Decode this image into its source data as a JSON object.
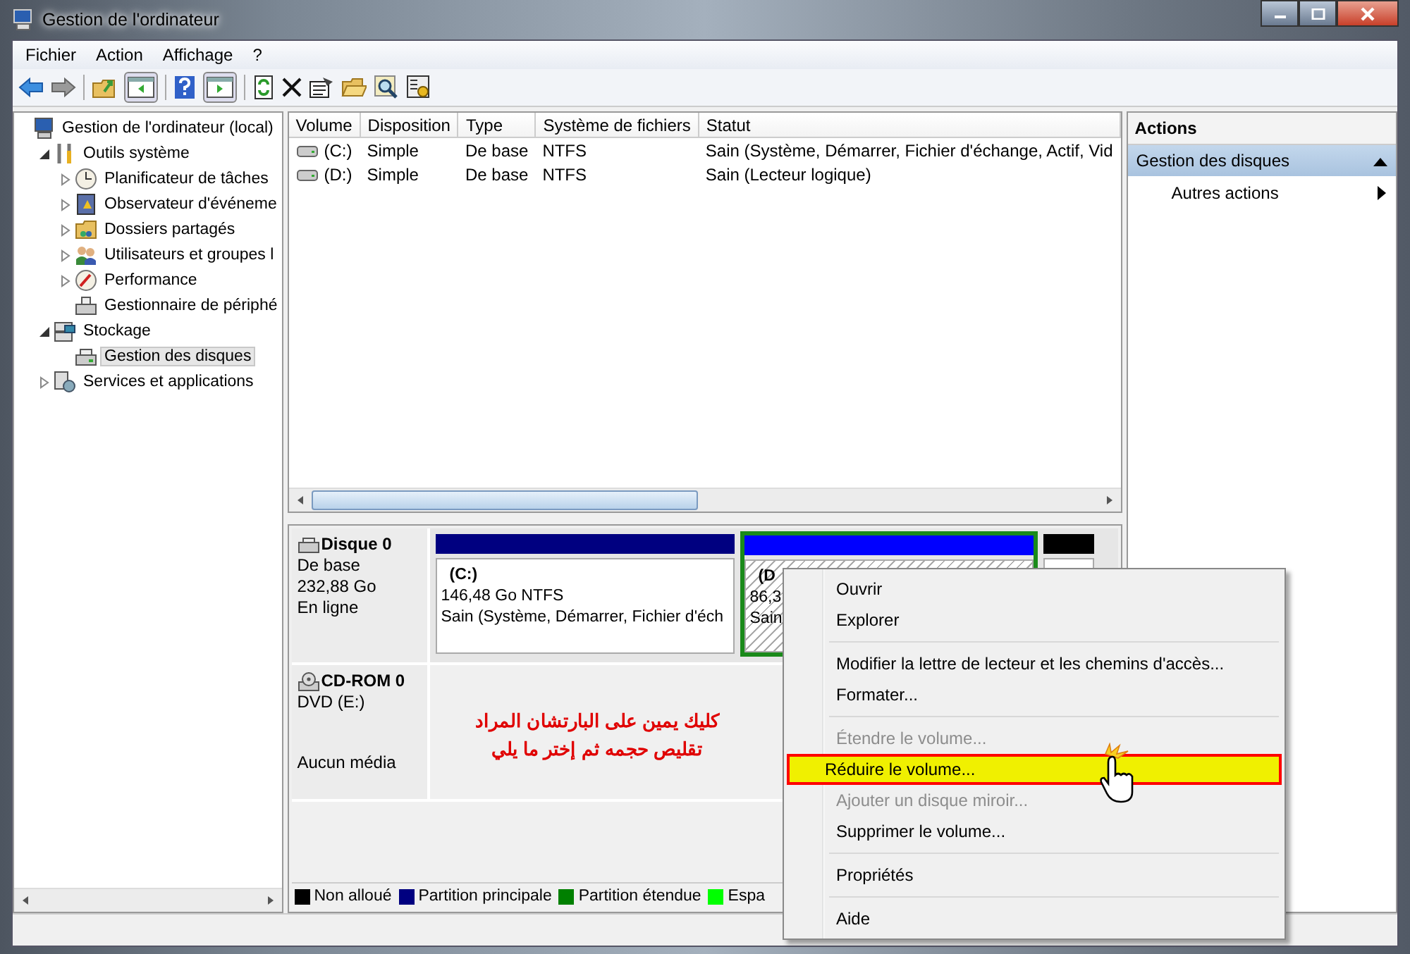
{
  "window": {
    "title": "Gestion de l'ordinateur"
  },
  "menu": [
    "Fichier",
    "Action",
    "Affichage",
    "?"
  ],
  "tree": [
    {
      "label": "Gestion de l'ordinateur (local)",
      "kind": "node",
      "selected": false,
      "children": [
        {
          "label": "Outils système",
          "kind": "branch",
          "expanded": true,
          "selected": false,
          "children": [
            {
              "label": "Planificateur de tâches",
              "kind": "branch",
              "expanded": false,
              "selected": false
            },
            {
              "label": "Observateur d'événeme",
              "kind": "branch",
              "expanded": false,
              "selected": false
            },
            {
              "label": "Dossiers partagés",
              "kind": "branch",
              "expanded": false,
              "selected": false
            },
            {
              "label": "Utilisateurs et groupes l",
              "kind": "branch",
              "expanded": false,
              "selected": false
            },
            {
              "label": "Performance",
              "kind": "branch",
              "expanded": false,
              "selected": false
            },
            {
              "label": "Gestionnaire de périphé",
              "kind": "node",
              "selected": false
            }
          ]
        },
        {
          "label": "Stockage",
          "kind": "branch",
          "expanded": true,
          "selected": false,
          "children": [
            {
              "label": "Gestion des disques",
              "kind": "node",
              "selected": true
            }
          ]
        },
        {
          "label": "Services et applications",
          "kind": "branch",
          "expanded": false,
          "selected": false
        }
      ]
    }
  ],
  "volumes": {
    "columns": [
      "Volume",
      "Disposition",
      "Type",
      "Système de fichiers",
      "Statut"
    ],
    "rows": [
      {
        "cells": [
          "(C:)",
          "Simple",
          "De base",
          "NTFS",
          "Sain (Système, Démarrer, Fichier d'échange, Actif, Vid"
        ]
      },
      {
        "cells": [
          "(D:)",
          "Simple",
          "De base",
          "NTFS",
          "Sain (Lecteur logique)"
        ]
      }
    ]
  },
  "disks": [
    {
      "kind": "disk",
      "name": "Disque 0",
      "lines": [
        "De base",
        "232,88 Go",
        "En ligne"
      ],
      "partitions": [
        {
          "kind": "primary",
          "selected": false,
          "lines": [
            "(C:)",
            "146,48 Go NTFS",
            "Sain (Système, Démarrer, Fichier d'éch"
          ]
        },
        {
          "kind": "logical",
          "selected": true,
          "lines": [
            "(D",
            "86,3",
            "Sain"
          ]
        },
        {
          "kind": "unallocated"
        }
      ]
    },
    {
      "kind": "cdrom",
      "name": "CD-ROM 0",
      "lines": [
        "DVD (E:)",
        "Aucun média"
      ],
      "annotation": [
        "كليك يمين على البارتشان المراد",
        "تقليص حجمه ثم إختر ما يلي"
      ]
    }
  ],
  "legend": [
    {
      "label": "Non alloué",
      "color": "#000000"
    },
    {
      "label": "Partition principale",
      "color": "#000080"
    },
    {
      "label": "Partition étendue",
      "color": "#008000"
    },
    {
      "label": "Espa",
      "color": "#00ff00"
    }
  ],
  "actions": {
    "header": "Actions",
    "sections": [
      {
        "title": "Gestion des disques",
        "expanded": true,
        "items": [
          "Autres actions"
        ]
      }
    ]
  },
  "context_menu": [
    {
      "kind": "item",
      "label": "Ouvrir",
      "disabled": false,
      "selected": false
    },
    {
      "kind": "item",
      "label": "Explorer",
      "disabled": false,
      "selected": false
    },
    {
      "kind": "separator"
    },
    {
      "kind": "item",
      "label": "Modifier la lettre de lecteur et les chemins d'accès...",
      "disabled": false,
      "selected": false
    },
    {
      "kind": "item",
      "label": "Formater...",
      "disabled": false,
      "selected": false
    },
    {
      "kind": "separator"
    },
    {
      "kind": "item",
      "label": "Étendre le volume...",
      "disabled": true,
      "selected": false
    },
    {
      "kind": "item",
      "label": "Réduire le volume...",
      "disabled": false,
      "selected": true
    },
    {
      "kind": "item",
      "label": "Ajouter un disque miroir...",
      "disabled": true,
      "selected": false
    },
    {
      "kind": "item",
      "label": "Supprimer le volume...",
      "disabled": false,
      "selected": false
    },
    {
      "kind": "separator"
    },
    {
      "kind": "item",
      "label": "Propriétés",
      "disabled": false,
      "selected": false
    },
    {
      "kind": "separator"
    },
    {
      "kind": "item",
      "label": "Aide",
      "disabled": false,
      "selected": false
    }
  ]
}
